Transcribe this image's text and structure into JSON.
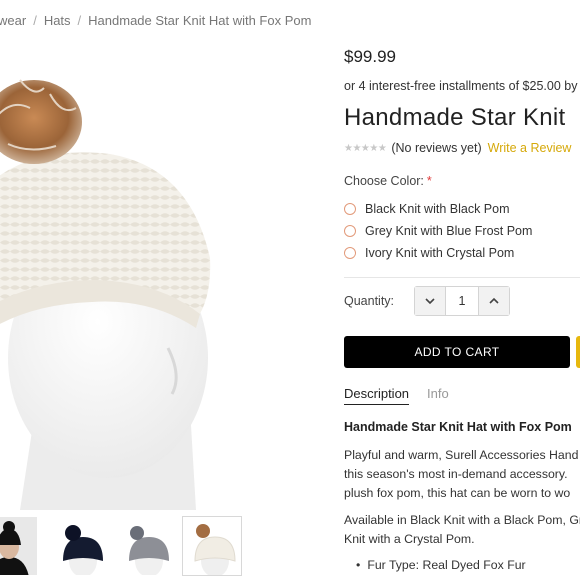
{
  "breadcrumb": {
    "items": [
      "wear",
      "Hats",
      "Handmade Star Knit Hat with Fox Pom"
    ],
    "separator": "/"
  },
  "product": {
    "price": "$99.99",
    "installments": "or 4 interest-free installments of $25.00 by",
    "title": "Handmade Star Knit",
    "reviews": {
      "stars": "★★★★★",
      "rating": 0,
      "count_text": "(No reviews yet)",
      "write_label": "Write a Review"
    },
    "color": {
      "label": "Choose Color:",
      "required_marker": "*",
      "options": [
        "Black Knit with Black Pom",
        "Grey Knit with Blue Frost Pom",
        "Ivory Knit with Crystal Pom"
      ]
    },
    "quantity": {
      "label": "Quantity:",
      "value": "1"
    },
    "add_to_cart_label": "ADD TO CART",
    "tabs": [
      {
        "label": "Description",
        "active": true
      },
      {
        "label": "Info",
        "active": false
      }
    ],
    "description": {
      "heading": "Handmade Star Knit Hat with Fox Pom",
      "p1_lines": [
        "Playful and warm, Surell Accessories Hand",
        "this season's most in-demand accessory.",
        "plush fox pom, this hat can be worn to wo"
      ],
      "p2_lines": [
        "Available in Black Knit with a Black Pom, Gr",
        "Knit with a Crystal Pom."
      ],
      "bullets": [
        "Fur Type: Real Dyed Fox Fur"
      ]
    }
  },
  "gallery": {
    "active_index": 3,
    "thumbnails": [
      "model-black-hat",
      "black-hat",
      "grey-hat",
      "ivory-hat"
    ]
  },
  "colors": {
    "accent_yellow": "#d6a90a",
    "radio_ring": "#e29a7a",
    "cart_button": "#000000",
    "required": "#e03a3a"
  }
}
